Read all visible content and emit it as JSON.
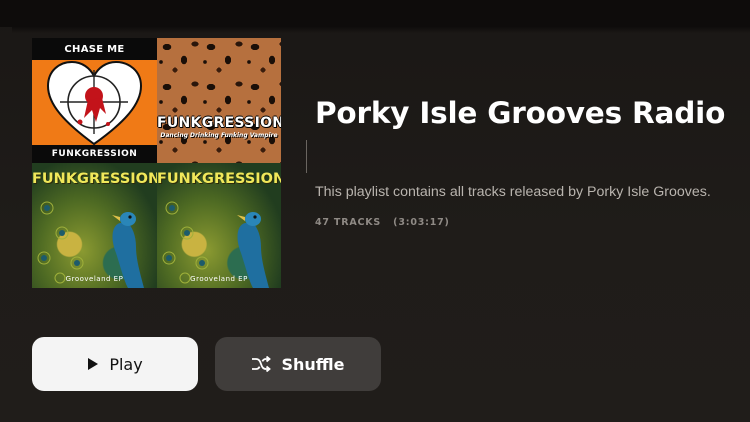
{
  "playlist": {
    "title": "Porky Isle Grooves Radio",
    "description": "This playlist contains all tracks released by Porky Isle Grooves.",
    "track_count": "47 TRACKS",
    "duration": "(3:03:17)"
  },
  "artwork": {
    "tiles": [
      {
        "title": "CHASE ME",
        "footer": "FUNKGRESSION",
        "icon": "heart-target-icon"
      },
      {
        "title": "FUNKGRESSION",
        "subtitle": "Dancing Drinking Funking Vampire"
      },
      {
        "title": "FUNKGRESSION",
        "footer": "Grooveland EP"
      },
      {
        "title": "FUNKGRESSION",
        "footer": "Grooveland EP"
      }
    ]
  },
  "actions": {
    "play_label": "Play",
    "play_icon": "play-icon",
    "shuffle_label": "Shuffle",
    "shuffle_icon": "shuffle-icon"
  },
  "colors": {
    "background": "#1f1c19",
    "play_button_bg": "#f4f4f4",
    "shuffle_button_bg": "#403d3b",
    "description_text": "#b9b4ae",
    "meta_text": "#8f8a85"
  }
}
